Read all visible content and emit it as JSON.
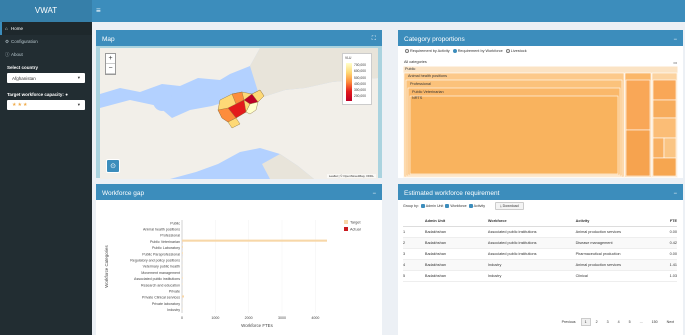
{
  "app": {
    "title": "VWAT"
  },
  "sidebar": {
    "items": [
      {
        "label": "Home"
      },
      {
        "label": "Configuration"
      },
      {
        "label": "About"
      }
    ],
    "country_label": "Select country",
    "country_value": "Afghanistan",
    "capacity_label": "Target workforce capacity:",
    "capacity_value": "★★★"
  },
  "map": {
    "title": "Map",
    "legend_title": "VLU",
    "legend_ticks": [
      "700,000",
      "600,000",
      "500,000",
      "400,000",
      "300,000",
      "200,000"
    ],
    "attribution": "Leaflet | © OpenStreetMap, ODbL"
  },
  "category": {
    "title": "Category proportions",
    "radio": [
      "Requirement by Activity",
      "Requirement by Workforce",
      "Livestock"
    ],
    "root_label": "All categories",
    "labels": [
      "Public",
      "Animal health positions",
      "Professional",
      "Public Veterinarian",
      "NRTS"
    ]
  },
  "gap": {
    "title": "Workforce gap",
    "ylabel": "Workforce Categories",
    "xlabel": "Workforce FTEs"
  },
  "estimate": {
    "title": "Estimated workforce requirement",
    "group_by": "Group by:",
    "toggles": [
      "Admin Unit",
      "Workforce",
      "Activity"
    ],
    "download": "Download",
    "columns": [
      "",
      "Admin Unit",
      "Workforce",
      "Activity",
      "FTE"
    ],
    "rows": [
      [
        "1",
        "Badakhshan",
        "Associated public institutions",
        "Animal production services",
        "0.00"
      ],
      [
        "2",
        "Badakhshan",
        "Associated public institutions",
        "Disease management",
        "0.42"
      ],
      [
        "3",
        "Badakhshan",
        "Associated public institutions",
        "Pharmaceutical production",
        "0.00"
      ],
      [
        "4",
        "Badakhshan",
        "Industry",
        "Animal production services",
        "1.41"
      ],
      [
        "5",
        "Badakhshan",
        "Industry",
        "Clinical",
        "1.03"
      ]
    ],
    "pager": [
      "Previous",
      "1",
      "2",
      "3",
      "4",
      "5",
      "...",
      "150",
      "Next"
    ]
  },
  "chart_data": {
    "type": "bar",
    "categories": [
      "Public",
      "Animal health positions",
      "Professional",
      "Public Veterinarian",
      "Public Laboratory",
      "Public Paraprofessional",
      "Regulatory and policy positions",
      "Veterinary public health",
      "Movement management",
      "Associated public institutions",
      "Research and education",
      "Private",
      "Private Clinical services",
      "Private laboratory",
      "Industry"
    ],
    "series": [
      {
        "name": "Target",
        "color": "#f7d7a8",
        "values": [
          0,
          0,
          0,
          4350,
          25,
          22,
          8,
          6,
          6,
          20,
          10,
          0,
          60,
          4,
          10
        ]
      },
      {
        "name": "Actual",
        "color": "#c9191e",
        "values": [
          0,
          0,
          0,
          2,
          1,
          1,
          0,
          0,
          0,
          0,
          0,
          0,
          1,
          0,
          0
        ]
      }
    ],
    "xlabel": "Workforce FTEs",
    "ylabel": "Workforce Categories",
    "xlim": [
      0,
      4500
    ],
    "x_ticks": [
      0,
      1000,
      2000,
      3000,
      4000
    ],
    "legend_position": "top-right"
  }
}
